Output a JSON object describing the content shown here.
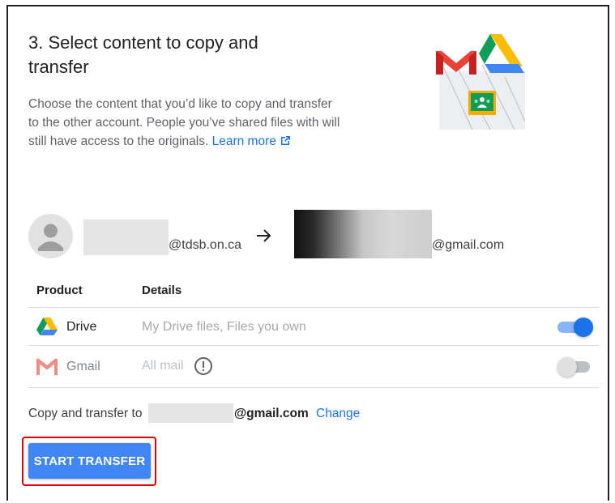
{
  "header": {
    "title": "3. Select content to copy and transfer",
    "description": "Choose the content that you’d like to copy and transfer to the other account. People you’ve shared files with will still have access to the originals.",
    "learn_more": "Learn more",
    "hero_icon": "gmail-drive-classroom-illustration"
  },
  "accounts": {
    "from_email": "@tdsb.on.ca",
    "to_email": "@gmail.com",
    "arrow_icon": "arrow-right-icon"
  },
  "table": {
    "headers": {
      "product": "Product",
      "details": "Details"
    },
    "rows": [
      {
        "name": "Drive",
        "details": "My Drive files, Files you own",
        "enabled": true,
        "icon": "google-drive-icon"
      },
      {
        "name": "Gmail",
        "details": "All mail",
        "enabled": false,
        "icon": "gmail-icon"
      }
    ]
  },
  "footer": {
    "copy_label": "Copy and transfer to",
    "dest_email": "@gmail.com",
    "change": "Change",
    "start_transfer": "START TRANSFER"
  },
  "colors": {
    "accent": "#1a73e8",
    "button": "#4285f4",
    "highlight": "#e00000",
    "toggle_on_track": "#8ab4f8",
    "toggle_off_track": "#bdc1c6"
  }
}
